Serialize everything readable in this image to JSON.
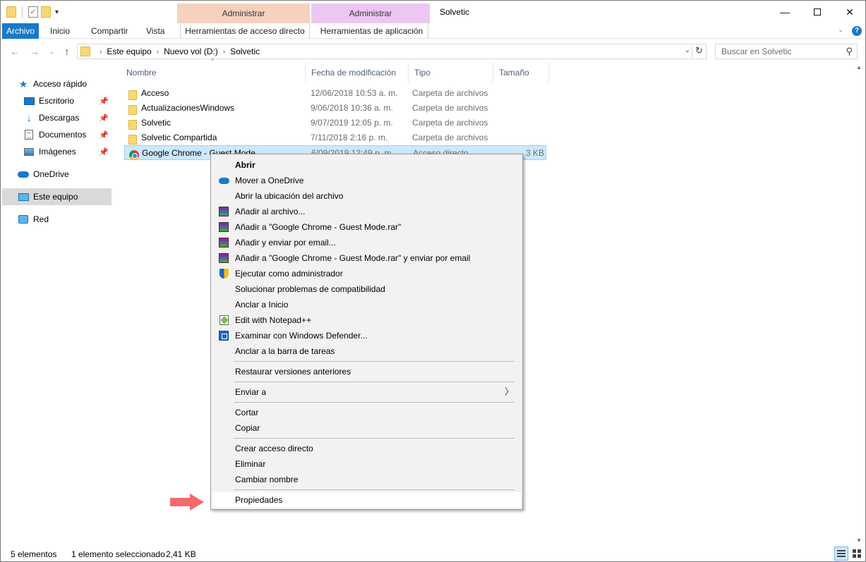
{
  "window": {
    "title": "Solvetic",
    "contextual_tabs": [
      {
        "group": "Administrar",
        "tab": "Herramientas de acceso directo",
        "color": "#f6d1bd"
      },
      {
        "group": "Administrar",
        "tab": "Herramientas de aplicación",
        "color": "#ecc7f2"
      }
    ]
  },
  "ribbon": {
    "tabs": [
      "Archivo",
      "Inicio",
      "Compartir",
      "Vista"
    ],
    "accent": "#1979ca"
  },
  "address": {
    "crumbs": [
      "Este equipo",
      "Nuevo vol (D:)",
      "Solvetic"
    ],
    "search_placeholder": "Buscar en Solvetic"
  },
  "nav_pane": {
    "items": [
      {
        "label": "Acceso rápido",
        "icon": "star-icon"
      },
      {
        "label": "Escritorio",
        "icon": "desktop-icon",
        "pinned": true
      },
      {
        "label": "Descargas",
        "icon": "download-icon",
        "pinned": true
      },
      {
        "label": "Documentos",
        "icon": "documents-icon",
        "pinned": true
      },
      {
        "label": "Imágenes",
        "icon": "pictures-icon",
        "pinned": true
      },
      {
        "label": "OneDrive",
        "icon": "cloud-icon"
      },
      {
        "label": "Este equipo",
        "icon": "computer-icon",
        "selected": true
      },
      {
        "label": "Red",
        "icon": "network-icon"
      }
    ]
  },
  "file_list": {
    "columns": [
      "Nombre",
      "Fecha de modificación",
      "Tipo",
      "Tamaño"
    ],
    "rows": [
      {
        "name": "Acceso",
        "date": "12/06/2018 10:53 a. m.",
        "type": "Carpeta de archivos",
        "size": "",
        "icon": "folder-icon"
      },
      {
        "name": "ActualizacionesWindows",
        "date": "9/06/2018 10:36 a. m.",
        "type": "Carpeta de archivos",
        "size": "",
        "icon": "folder-icon"
      },
      {
        "name": "Solvetic",
        "date": "9/07/2019 12:05 p. m.",
        "type": "Carpeta de archivos",
        "size": "",
        "icon": "folder-icon"
      },
      {
        "name": "Solvetic Compartida",
        "date": "7/11/2018 2:16 p. m.",
        "type": "Carpeta de archivos",
        "size": "",
        "icon": "folder-icon"
      },
      {
        "name": "Google Chrome - Guest Mode",
        "date": "6/09/2019 12:49 p. m.",
        "type": "Acceso directo",
        "size": "3 KB",
        "icon": "chrome-icon",
        "selected": true
      }
    ]
  },
  "context_menu": {
    "items": [
      "Abrir",
      "Mover a OneDrive",
      "Abrir la ubicación del archivo",
      "Añadir al archivo...",
      "Añadir a \"Google Chrome - Guest Mode.rar\"",
      "Añadir y enviar por email...",
      "Añadir a \"Google Chrome - Guest Mode.rar\" y enviar por email",
      "Ejecutar como administrador",
      "Solucionar problemas de compatibilidad",
      "Anclar a Inicio",
      "Edit with Notepad++",
      "Examinar con Windows Defender...",
      "Anclar a la barra de tareas",
      "Restaurar versiones anteriores",
      "Enviar a",
      "Cortar",
      "Copiar",
      "Crear acceso directo",
      "Eliminar",
      "Cambiar nombre",
      "Propiedades"
    ],
    "highlight_color": "#f26b6b"
  },
  "status": {
    "count": "5 elementos",
    "selection": "1 elemento seleccionado",
    "size": "2,41 KB"
  }
}
